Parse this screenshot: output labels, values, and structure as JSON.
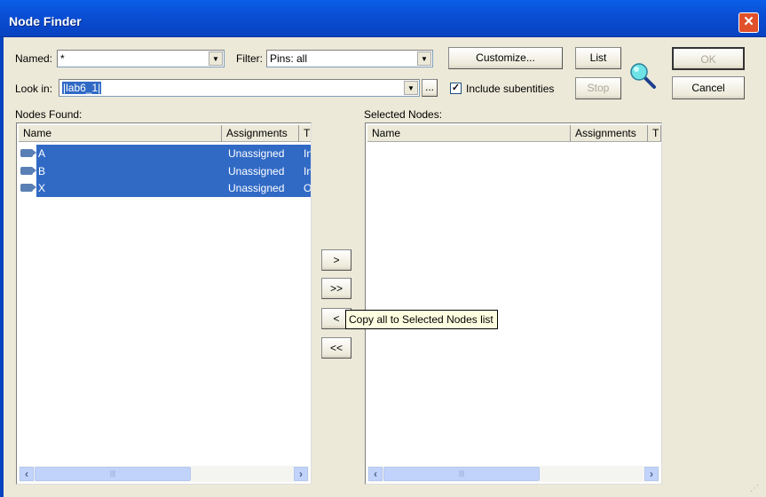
{
  "window": {
    "title": "Node Finder",
    "close_icon": "close-icon"
  },
  "named": {
    "label": "Named:",
    "value": "*"
  },
  "filter": {
    "label": "Filter:",
    "value": "Pins: all"
  },
  "look_in": {
    "label": "Look in:",
    "value": "|lab6_1|",
    "browse_label": "..."
  },
  "include_subentities": {
    "label": "Include subentities",
    "checked": true
  },
  "buttons": {
    "customize": "Customize...",
    "list": "List",
    "stop": "Stop",
    "ok": "OK",
    "cancel": "Cancel",
    "add": ">",
    "add_all": ">>",
    "remove": "<",
    "remove_all": "<<"
  },
  "search_icon": "magnifier-icon",
  "nodes_found": {
    "label": "Nodes Found:",
    "columns": [
      "Name",
      "Assignments",
      "T"
    ],
    "rows": [
      {
        "name": "A",
        "assignments": "Unassigned",
        "type": "Input"
      },
      {
        "name": "B",
        "assignments": "Unassigned",
        "type": "Input"
      },
      {
        "name": "X",
        "assignments": "Unassigned",
        "type": "Output"
      }
    ]
  },
  "selected_nodes": {
    "label": "Selected Nodes:",
    "columns": [
      "Name",
      "Assignments",
      "T"
    ],
    "rows": []
  },
  "tooltip": "Copy all to Selected Nodes list",
  "colors": {
    "title_bar": "#0a4fd6",
    "selection": "#316ac5",
    "dialog": "#ece9d8"
  }
}
